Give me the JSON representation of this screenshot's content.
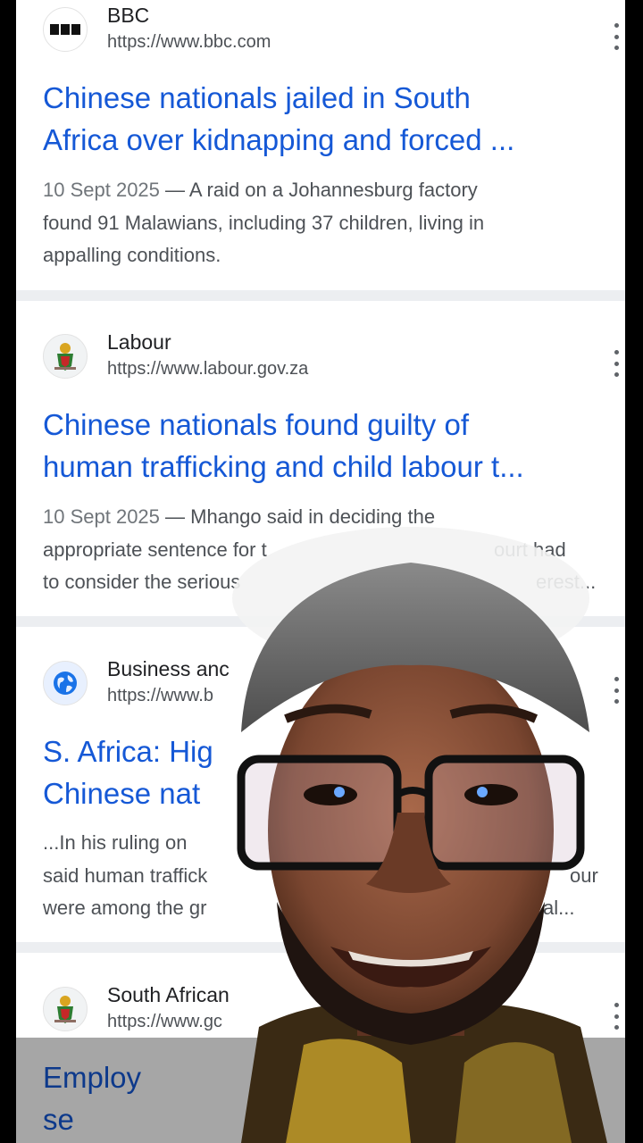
{
  "results": [
    {
      "site_name": "BBC",
      "url": "https://www.bbc.com",
      "title_line1": "Chinese nationals jailed in South",
      "title_line2": "Africa over kidnapping and forced ...",
      "snippet_line1": "10 Sept 2025 — A raid on a Johannesburg factory",
      "snippet_line2": "found 91 Malawians, including 37 children, living in",
      "snippet_line3": "appalling conditions.",
      "favicon": "bbc-logo-icon"
    },
    {
      "site_name": "Labour",
      "url": "https://www.labour.gov.za",
      "title_line1": "Chinese nationals found guilty of",
      "title_line2": "human trafficking and child labour t...",
      "snippet_line1": "10 Sept 2025 — Mhango said in deciding the",
      "snippet_line2": "appropriate sentence for t",
      "snippet_line2b": "ourt had",
      "snippet_line3": "to consider the serious",
      "snippet_line3b": "erest...",
      "favicon": "sa-coat-of-arms-icon"
    },
    {
      "site_name": "Business anc",
      "url": "https://www.b",
      "title_line1": "S. Africa: Hig",
      "title_line2": "Chinese nat",
      "snippet_line1": "...In his ruling on",
      "snippet_line2": "said human traffick",
      "snippet_line2b": "our",
      "snippet_line3": "were among the gr",
      "snippet_line3b": "al...",
      "favicon": "globe-icon"
    },
    {
      "site_name": "South African",
      "url": "https://www.gc",
      "title_line1": "Employ",
      "title_line2": "se",
      "favicon": "sa-coat-of-arms-icon"
    }
  ],
  "colors": {
    "link": "#1558d6",
    "snippet": "#4d5156",
    "separator": "#eceef1"
  }
}
